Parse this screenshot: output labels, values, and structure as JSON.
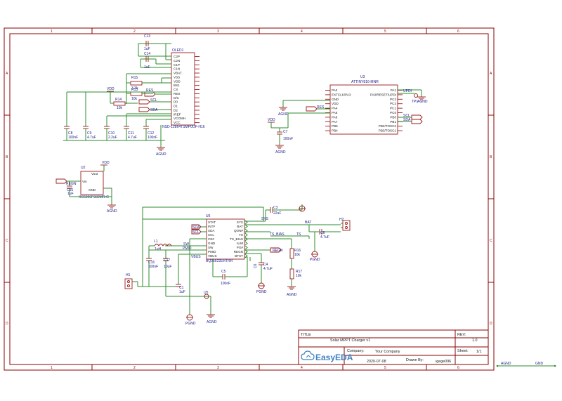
{
  "title_block": {
    "title_label": "TITLE",
    "title": "Solar MPPT Charger v1",
    "rev_label": "REV:",
    "rev": "1.0",
    "company_label": "Company:",
    "company": "Your Company",
    "sheet_label": "Sheet:",
    "sheet": "1/1",
    "date": "2020-07-08",
    "drawn_by_label": "Drawn By:",
    "drawn_by": "igege096",
    "logo": "EasyEDA"
  },
  "border": {
    "cols": [
      "1",
      "2",
      "3",
      "4",
      "5",
      "6"
    ],
    "rows": [
      "A",
      "B",
      "C",
      "D"
    ]
  },
  "net_legend": {
    "agnd": "AGND",
    "gnd": "GND"
  },
  "oled": {
    "ref": "OLED1",
    "part": "NSD-12864TSMP0OF-H16",
    "pins": [
      "C2P",
      "C2N",
      "C1P",
      "C1N",
      "VBAT",
      "VSS",
      "VDD",
      "BS1",
      "CS",
      "RES",
      "D/C",
      "D0",
      "D1",
      "D2",
      "IREF",
      "VCOMH",
      "VCC"
    ],
    "c13": "C13",
    "c13_val": "1uF",
    "c14": "C14",
    "c14_val": "1uF",
    "r15": "R15",
    "r15_val": "3.3k",
    "r13": "R13",
    "r13_val": "10k",
    "r14": "R14",
    "r14_val": "10k",
    "vdd": "VDD",
    "net_res": "RES",
    "net_scl": "SCL",
    "net_sda": "SDA",
    "caps": [
      {
        "ref": "C8",
        "val": "100nF"
      },
      {
        "ref": "C9",
        "val": "4.7uF"
      },
      {
        "ref": "C10",
        "val": "2.2uF"
      },
      {
        "ref": "C11",
        "val": "4.7uF"
      },
      {
        "ref": "C12",
        "val": "100nF"
      }
    ],
    "gnd": "AGND"
  },
  "mcu": {
    "ref": "U3",
    "part": "ATTINY816-MNR",
    "left_pins": [
      "PA2",
      "EXTCLK/PA3",
      "GND",
      "VDD",
      "PA4",
      "PA5",
      "PA6",
      "PA7",
      "PB5",
      "PB4"
    ],
    "right_pins": [
      "PA1",
      "PA0/RESET/UPDI",
      "PC3",
      "PC2",
      "PC1",
      "PC0",
      "PB0",
      "PB1",
      "PB2/TOSC2",
      "PB3/TOSC1"
    ],
    "top_pin": "PA1",
    "updi": "UPDI",
    "tp1": "TP1",
    "net_res": "RES",
    "net_scl": "SCL",
    "net_sda": "SDA",
    "vdd": "VDD",
    "c7": "C7",
    "c7_val": "100nF",
    "gnd": "AGND"
  },
  "ldo": {
    "ref": "U2",
    "part": "XC6206P332MR-G",
    "vin": "Vin",
    "vout": "Vout",
    "gnd_pin": "GND",
    "vdd": "VDD",
    "net_regn": "REGN",
    "c15": "C15",
    "c15_val": "1uF",
    "gnd": "AGND"
  },
  "charger": {
    "ref": "U5",
    "part": "BQ25622ERTRR",
    "left_pins": [
      "STAT",
      "INT#",
      "SDA",
      "SCL",
      "CE#",
      "GND",
      "SW",
      "PMID",
      "VBUS"
    ],
    "right_pins": [
      "SYS",
      "BAT",
      "QON#",
      "TS",
      "TS_BIAS",
      "ILIM",
      "PG#",
      "REGN",
      "BTST"
    ],
    "c3": "C3",
    "c3_val": "22uF",
    "c4": "C4",
    "c4_val": "4.7uF",
    "c5": "C5",
    "c5_val": "100nF",
    "c6": "C6",
    "c6_val": "4.7uF",
    "c16": "C16",
    "c16_val": "100nF",
    "c17": "C17",
    "c17_val": "10uF",
    "c1": "C1",
    "c1_val": "1uF",
    "l1": "L1",
    "l1_val": "1uH",
    "r16": "R16",
    "r16_val": "10k",
    "r17": "R17",
    "r17_val": "10k",
    "h1": "H1",
    "h2": "H2",
    "net_sys": "SYS",
    "net_bat": "BAT",
    "net_ts": "TS",
    "net_ts_bias": "TS_BIAS",
    "net_sw": "SW",
    "net_pmid": "PMID",
    "net_vbus": "VBUS",
    "net_regn": "REGN",
    "net_sda": "SDA",
    "net_scl": "SCL",
    "gnd": "PGND",
    "u5b": "U5"
  }
}
